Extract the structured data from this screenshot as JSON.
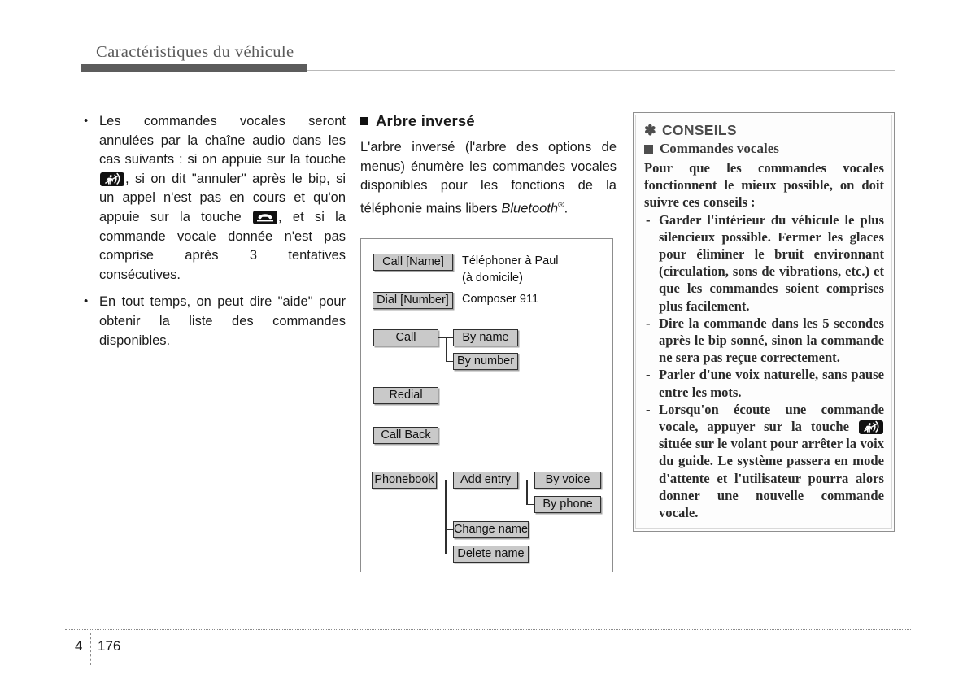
{
  "header": {
    "title": "Caractéristiques du véhicule"
  },
  "footer": {
    "chapter": "4",
    "page_number": "176"
  },
  "left_column": {
    "bullets": [
      {
        "segments": [
          {
            "type": "text",
            "value": "Les commandes vocales seront annulées par la chaîne audio dans les cas suivants : si on appuie sur la touche "
          },
          {
            "type": "icon",
            "icon": "voice-command-key-icon"
          },
          {
            "type": "text",
            "value": ", si on dit \"annuler\" après le bip, si un appel n'est pas en cours et qu'on appuie sur la touche "
          },
          {
            "type": "icon",
            "icon": "hang-up-key-icon"
          },
          {
            "type": "text",
            "value": ", et si la commande vocale donnée n'est pas comprise après 3 tentatives consécutives."
          }
        ],
        "text_1": "Les commandes vocales seront annulées par la chaîne audio dans les cas suivants : si on appuie sur la touche ",
        "text_2": ", si on dit \"annuler\" après le bip, si un appel n'est pas en cours et qu'on appuie sur la touche ",
        "text_3": ", et si la commande vocale donnée n'est pas comprise après 3 tentatives consécutives."
      },
      {
        "text_1": "En tout temps, on peut dire \"aide\" pour obtenir la liste des commandes disponibles."
      }
    ]
  },
  "middle_column": {
    "heading": "Arbre inversé",
    "paragraph_part1": "L'arbre inversé (l'arbre des options de menus) énumère les commandes vocales disponibles pour les fonctions de la téléphonie mains libers ",
    "paragraph_brand": "Bluetooth",
    "paragraph_sup": "®",
    "paragraph_end": ".",
    "diagram": {
      "nodes": {
        "call_name": "Call [Name]",
        "dial_number": "Dial [Number]",
        "call": "Call",
        "by_name": "By name",
        "by_number": "By number",
        "redial": "Redial",
        "call_back": "Call Back",
        "phonebook": "Phonebook",
        "add_entry": "Add entry",
        "by_voice": "By voice",
        "by_phone": "By phone",
        "change_name": "Change name",
        "delete_name": "Delete name"
      },
      "annotations": {
        "call_name_line1": "Téléphoner à Paul",
        "call_name_line2": "(à domicile)",
        "dial_number_line1": "Composer 911"
      }
    }
  },
  "right_column": {
    "tips_title": "CONSEILS",
    "tips_title_marker": "✽",
    "tips_subtitle": "Commandes vocales",
    "intro": "Pour que les commandes vocales fonctionnent le mieux possible, on doit suivre ces conseils :",
    "items": [
      {
        "text": "Garder l'intérieur du véhicule le plus silencieux possible. Fermer les glaces pour éliminer le bruit environnant (circulation, sons de vibrations, etc.) et que les commandes soient comprises plus facilement."
      },
      {
        "text": "Dire la commande dans les 5 secondes après le bip sonné, sinon la commande ne sera pas reçue correctement."
      },
      {
        "text": "Parler d'une voix naturelle, sans pause entre les mots."
      },
      {
        "text_before_icon": "Lorsqu'on écoute une commande vocale, appuyer sur la touche ",
        "icon": "voice-command-key-icon",
        "text_after_icon": " située sur le volant pour arrêter la voix du guide. Le système passera en mode d'attente et l'utilisateur pourra alors donner une nouvelle commande vocale."
      }
    ]
  },
  "colors": {
    "header_bar": "#5c5c5c",
    "header_text": "#595959",
    "node_fill": "#c9c9c9",
    "node_border": "#2f2f2f",
    "key_icon_bg": "#111111",
    "tips_border": "#8f8f8f"
  }
}
